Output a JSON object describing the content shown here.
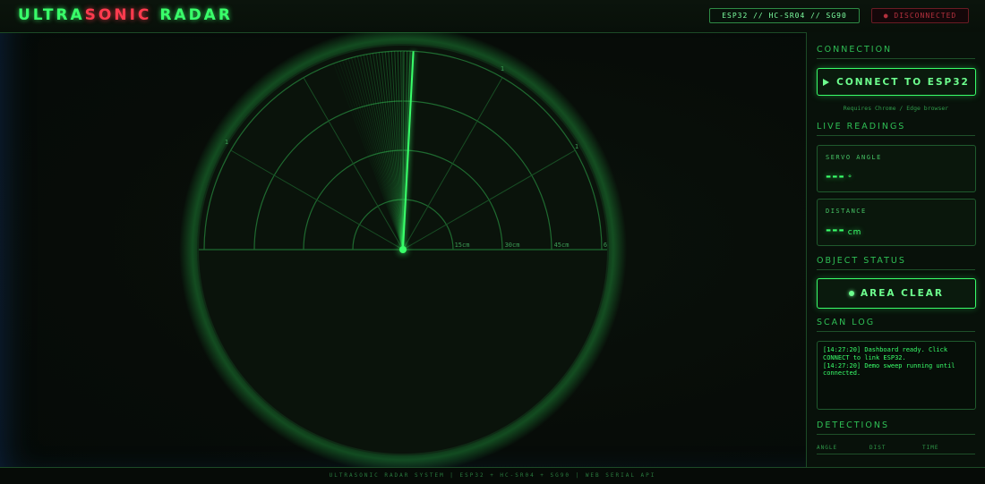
{
  "app": {
    "title_main_a": "ULTRA",
    "title_accent": "SONIC",
    "title_main_b": " RADAR"
  },
  "header": {
    "device_chip": "ESP32 // HC-SR04 // SG90",
    "connection_status": "● DISCONNECTED"
  },
  "radar": {
    "sweep_angle_deg": 87,
    "range_labels": [
      "15cm",
      "30cm",
      "45cm",
      "6"
    ],
    "angle_labels": [
      "1",
      "1",
      "1"
    ],
    "colors": {
      "grid": "#1f6a30",
      "sweep": "#39ff6a",
      "bg": "#0a120b"
    }
  },
  "panel": {
    "connection": {
      "title": "CONNECTION",
      "connect_label": "CONNECT TO ESP32",
      "note": "Requires Chrome / Edge browser"
    },
    "live": {
      "title": "LIVE READINGS",
      "servo_label": "SERVO ANGLE",
      "servo_value": "---",
      "servo_unit": "°",
      "distance_label": "DISTANCE",
      "distance_value": "---",
      "distance_unit": "cm"
    },
    "object": {
      "title": "OBJECT STATUS",
      "status_label": "AREA CLEAR"
    },
    "log": {
      "title": "SCAN LOG",
      "lines": [
        "[14:27:20] Dashboard ready. Click CONNECT to link ESP32.",
        "[14:27:20] Demo sweep running until connected."
      ]
    },
    "detections": {
      "title": "DETECTIONS",
      "columns": [
        "ANGLE",
        "DIST",
        "TIME"
      ]
    }
  },
  "footer": {
    "text": "ULTRASONIC RADAR SYSTEM  |  ESP32 + HC-SR04 + SG90  |  WEB SERIAL API"
  }
}
